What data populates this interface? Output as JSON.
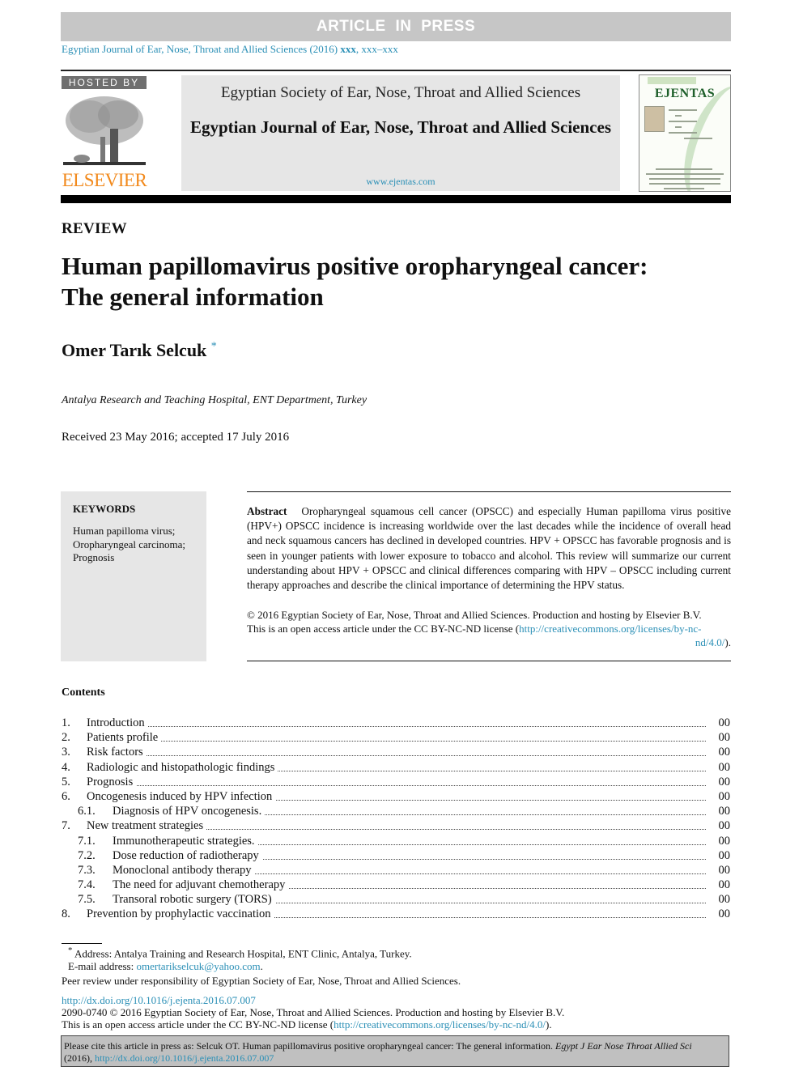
{
  "banner": {
    "text": "ARTICLE IN PRESS"
  },
  "journal_line": {
    "text": "Egyptian Journal of Ear, Nose, Throat and Allied Sciences (2016) ",
    "vol": "xxx",
    "pages": ", xxx–xxx"
  },
  "header": {
    "hosted_by": "HOSTED BY",
    "publisher_logo": "ELSEVIER",
    "society": "Egyptian Society of Ear, Nose, Throat and Allied Sciences",
    "journal_title": "Egyptian Journal of Ear, Nose, Throat and Allied Sciences",
    "url": "www.ejentas.com",
    "cover_title": "EJENTAS"
  },
  "colors": {
    "link": "#2a8fb6",
    "elsevier_orange": "#f28a1d",
    "banner_gray": "#c6c6c6",
    "box_gray": "#e6e6e6"
  },
  "article": {
    "type": "REVIEW",
    "title": "Human papillomavirus positive oropharyngeal cancer: The general information",
    "author": "Omer Tarık Selcuk",
    "author_mark": "*",
    "affiliation": "Antalya Research and Teaching Hospital, ENT Department, Turkey",
    "received": "Received 23 May 2016; accepted 17 July 2016"
  },
  "keywords": {
    "heading": "KEYWORDS",
    "items": [
      "Human papilloma virus;",
      "Oropharyngeal carcinoma;",
      "Prognosis"
    ]
  },
  "abstract": {
    "label": "Abstract",
    "text": "Oropharyngeal squamous cell cancer (OPSCC) and especially Human papilloma virus positive (HPV+) OPSCC incidence is increasing worldwide over the last decades while the incidence of overall head and neck squamous cancers has declined in developed countries. HPV + OPSCC has favorable prognosis and is seen in younger patients with lower exposure to tobacco and alcohol. This review will summarize our current understanding about HPV + OPSCC and clinical differences comparing with HPV – OPSCC including current therapy approaches and describe the clinical importance of determining the HPV status.",
    "copyright": "© 2016 Egyptian Society of Ear, Nose, Throat and Allied Sciences. Production and hosting by Elsevier B.V.",
    "license_prefix": "This is an open access article under the CC BY-NC-ND license (",
    "license_url_1": "http://creativecommons.org/licenses/by-nc-",
    "license_url_2": "nd/4.0/",
    "license_suffix": ")."
  },
  "contents": {
    "heading": "Contents",
    "items": [
      {
        "num": "1.",
        "label": "Introduction",
        "page": "00",
        "sub": false
      },
      {
        "num": "2.",
        "label": "Patients profile",
        "page": "00",
        "sub": false
      },
      {
        "num": "3.",
        "label": "Risk factors",
        "page": "00",
        "sub": false
      },
      {
        "num": "4.",
        "label": "Radiologic and histopathologic findings",
        "page": "00",
        "sub": false
      },
      {
        "num": "5.",
        "label": "Prognosis",
        "page": "00",
        "sub": false
      },
      {
        "num": "6.",
        "label": "Oncogenesis induced by HPV infection",
        "page": "00",
        "sub": false
      },
      {
        "num": "6.1.",
        "label": "Diagnosis of HPV oncogenesis.",
        "page": "00",
        "sub": true
      },
      {
        "num": "7.",
        "label": "New treatment strategies",
        "page": "00",
        "sub": false
      },
      {
        "num": "7.1.",
        "label": "Immunotherapeutic strategies.",
        "page": "00",
        "sub": true
      },
      {
        "num": "7.2.",
        "label": "Dose reduction of radiotherapy",
        "page": "00",
        "sub": true
      },
      {
        "num": "7.3.",
        "label": "Monoclonal antibody therapy",
        "page": "00",
        "sub": true
      },
      {
        "num": "7.4.",
        "label": "The need for adjuvant chemotherapy",
        "page": "00",
        "sub": true
      },
      {
        "num": "7.5.",
        "label": "Transoral robotic surgery (TORS)",
        "page": "00",
        "sub": true
      },
      {
        "num": "8.",
        "label": "Prevention by prophylactic vaccination",
        "page": "00",
        "sub": false
      }
    ]
  },
  "footnotes": {
    "mark": "*",
    "address": "Address: Antalya Training and Research Hospital, ENT Clinic, Antalya, Turkey.",
    "email_label": "E-mail address: ",
    "email": "omertarikselcuk@yahoo.com",
    "email_end": ".",
    "peer_review": "Peer review under responsibility of Egyptian Society of Ear, Nose, Throat and Allied Sciences.",
    "doi": "http://dx.doi.org/10.1016/j.ejenta.2016.07.007",
    "issn_copyright": "2090-0740 © 2016 Egyptian Society of Ear, Nose, Throat and Allied Sciences. Production and hosting by Elsevier B.V.",
    "license_prefix": "This is an open access article under the CC BY-NC-ND license (",
    "license_url": "http://creativecommons.org/licenses/by-nc-nd/4.0/",
    "license_suffix": ")."
  },
  "citation": {
    "text": "Please cite this article in press as: Selcuk OT. Human papillomavirus positive oropharyngeal cancer: The general information. ",
    "journal_abbrev": "Egypt J Ear Nose Throat Allied Sci",
    "year": "(2016), ",
    "doi": "http://dx.doi.org/10.1016/j.ejenta.2016.07.007"
  }
}
